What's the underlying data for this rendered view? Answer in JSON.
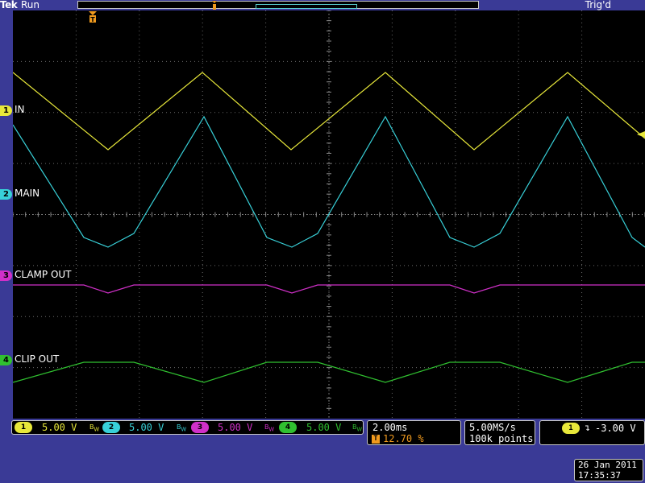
{
  "header": {
    "brand": "Tek",
    "run_state": "Run",
    "trigger_state": "Trig'd"
  },
  "channels": [
    {
      "number": "1",
      "label": "IN",
      "scale": "5.00 V",
      "color": "#e8e83a"
    },
    {
      "number": "2",
      "label": "MAIN",
      "scale": "5.00 V",
      "color": "#38d0d8"
    },
    {
      "number": "3",
      "label": "CLAMP OUT",
      "scale": "5.00 V",
      "color": "#d030c8"
    },
    {
      "number": "4",
      "label": "CLIP OUT",
      "scale": "5.00 V",
      "color": "#30c030"
    }
  ],
  "bandwidth_icon": "bandwidth-limit-icon",
  "timebase": {
    "horizontal_scale": "2.00ms",
    "trigger_position": "12.70 %"
  },
  "acquisition": {
    "sample_rate": "5.00MS/s",
    "record_length": "100k points"
  },
  "trigger": {
    "source": "1",
    "slope_icon": "falling-edge-icon",
    "level": "-3.00 V"
  },
  "datetime": {
    "date": "26 Jan  2011",
    "time": "17:35:37"
  },
  "colors": {
    "background": "#3a3a96",
    "screen": "#000000",
    "trigger_marker": "#f09a1e"
  }
}
